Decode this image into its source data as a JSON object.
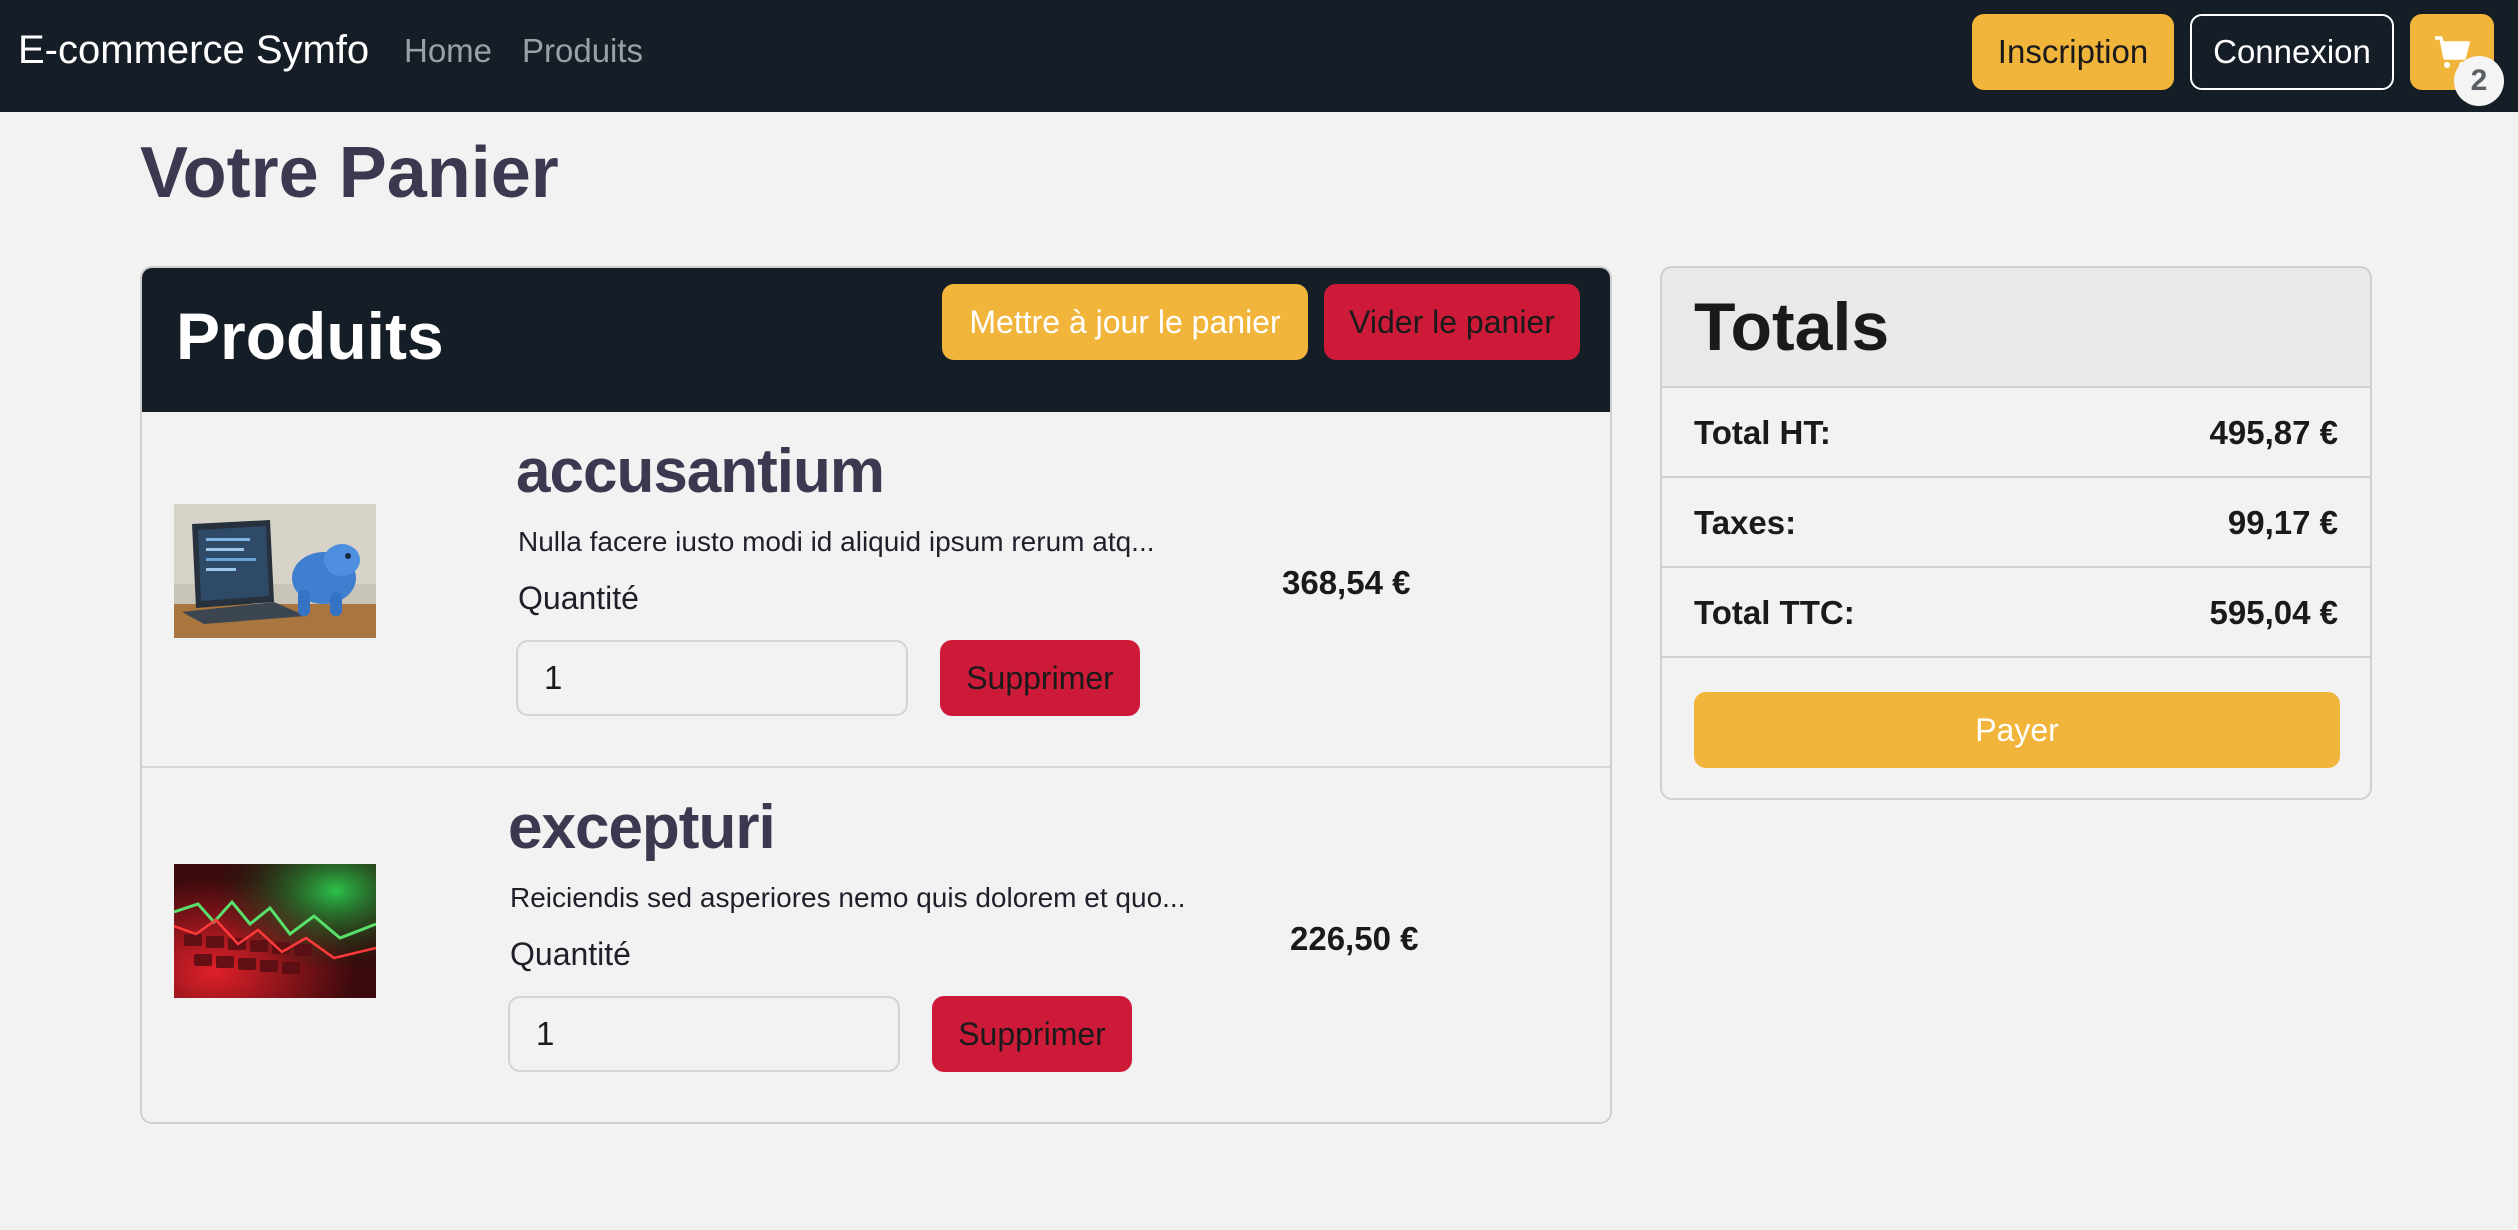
{
  "navbar": {
    "brand": "E-commerce Symfo",
    "links": [
      "Home",
      "Produits"
    ],
    "signup_label": "Inscription",
    "login_label": "Connexion",
    "cart_icon": "cart-icon",
    "cart_count": "2"
  },
  "page": {
    "title": "Votre Panier"
  },
  "products": {
    "header_title": "Produits",
    "update_label": "Mettre à jour le panier",
    "empty_label": "Vider le panier",
    "items": [
      {
        "name": "accusantium",
        "description": "Nulla facere iusto modi id aliquid ipsum rerum atq...",
        "quantity_label": "Quantité",
        "quantity": "1",
        "delete_label": "Supprimer",
        "price": "368,54 €"
      },
      {
        "name": "excepturi",
        "description": "Reiciendis sed asperiores nemo quis dolorem et quo...",
        "quantity_label": "Quantité",
        "quantity": "1",
        "delete_label": "Supprimer",
        "price": "226,50 €"
      }
    ]
  },
  "totals": {
    "title": "Totals",
    "rows": [
      {
        "label": "Total HT:",
        "value": "495,87 €"
      },
      {
        "label": "Taxes:",
        "value": "99,17 €"
      },
      {
        "label": "Total TTC:",
        "value": "595,04 €"
      }
    ],
    "pay_label": "Payer"
  },
  "colors": {
    "navbar_bg": "#151d26",
    "accent_yellow": "#f2b53c",
    "danger_red": "#cc1a38",
    "page_bg": "#f2f2f2"
  }
}
